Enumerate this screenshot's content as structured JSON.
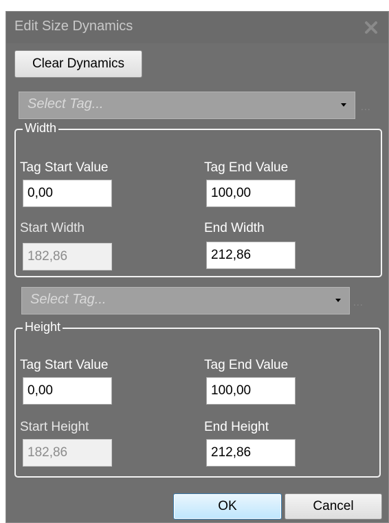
{
  "window": {
    "title": "Edit Size Dynamics"
  },
  "toolbar": {
    "clear_label": "Clear Dynamics"
  },
  "width_section": {
    "tag_select_placeholder": "Select Tag...",
    "ellipsis": "...",
    "legend": "Width",
    "tag_start_label": "Tag Start Value",
    "tag_start_value": "0,00",
    "tag_end_label": "Tag End Value",
    "tag_end_value": "100,00",
    "start_label": "Start Width",
    "start_value": "182,86",
    "end_label": "End Width",
    "end_value": "212,86"
  },
  "height_section": {
    "tag_select_placeholder": "Select Tag...",
    "ellipsis": "...",
    "legend": "Height",
    "tag_start_label": "Tag Start Value",
    "tag_start_value": "0,00",
    "tag_end_label": "Tag End Value",
    "tag_end_value": "100,00",
    "start_label": "Start Height",
    "start_value": "182,86",
    "end_label": "End Height",
    "end_value": "212,86"
  },
  "footer": {
    "ok_label": "OK",
    "cancel_label": "Cancel"
  },
  "icons": {
    "close": "close-icon",
    "dropdown": "chevron-down-icon"
  },
  "colors": {
    "window_bg": "#6f6f6f",
    "title_text": "#c9c9c9",
    "ok_border": "#3c7fb1",
    "select_bg": "#a0a0a0"
  }
}
